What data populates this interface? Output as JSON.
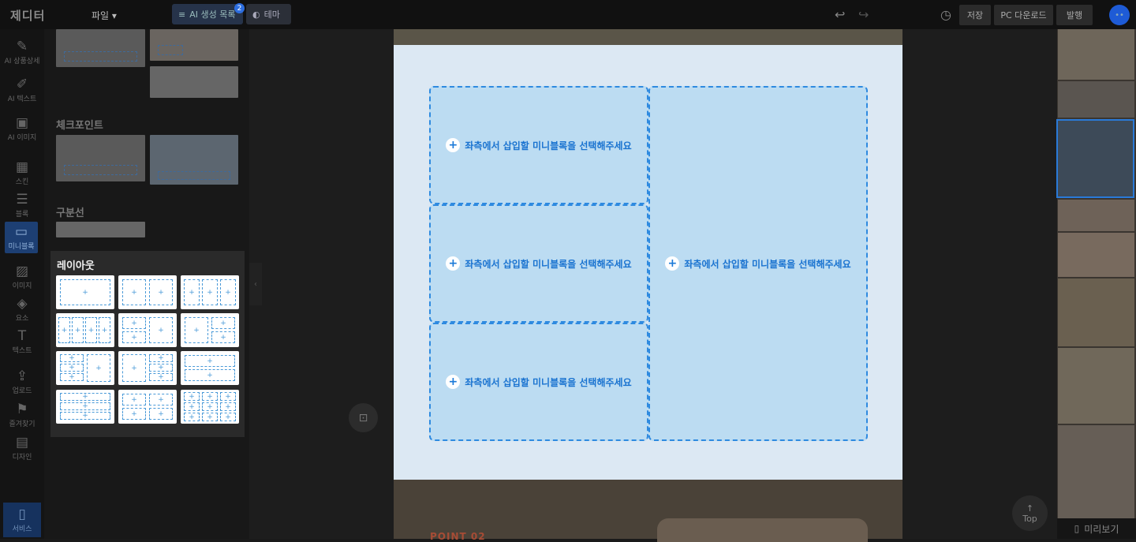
{
  "app": {
    "logo": "제디터",
    "file_menu": "파일",
    "file_chevron": "▾"
  },
  "toolbar": {
    "ai_list": "AI 생성 목록",
    "ai_list_badge": "2",
    "theme": "테마",
    "save": "저장",
    "pc_download": "PC 다운로드",
    "publish": "발행"
  },
  "left_nav": [
    {
      "label": "AI 상품상세",
      "icon": "ai-product-icon"
    },
    {
      "label": "AI 텍스트",
      "icon": "ai-text-icon"
    },
    {
      "label": "AI 이미지",
      "icon": "ai-image-icon"
    },
    {
      "label": "스킨",
      "icon": "skin-icon"
    },
    {
      "label": "블록",
      "icon": "block-icon"
    },
    {
      "label": "미니블록",
      "icon": "mini-block-icon"
    },
    {
      "label": "이미지",
      "icon": "image-icon"
    },
    {
      "label": "요소",
      "icon": "element-icon"
    },
    {
      "label": "텍스트",
      "icon": "text-icon"
    },
    {
      "label": "업로드",
      "icon": "upload-icon"
    },
    {
      "label": "즐겨찾기",
      "icon": "bookmark-icon"
    },
    {
      "label": "디자인",
      "icon": "my-design-icon"
    },
    {
      "label": "서비스",
      "icon": "service-icon"
    }
  ],
  "panel": {
    "sections": [
      "체크포인트",
      "구분선"
    ],
    "layout_title": "레이아웃"
  },
  "canvas": {
    "placeholder": "좌측에서 삽입할 미니블록을 선택해주세요",
    "plus": "+",
    "next_section_label": "POINT 02"
  },
  "buttons": {
    "top": "Top",
    "top_arrow": "↑",
    "preview": "미리보기"
  },
  "colors": {
    "accent": "#2e8ae0",
    "cell_bg": "#bcdcf2",
    "block_bg": "#dce8f3"
  }
}
